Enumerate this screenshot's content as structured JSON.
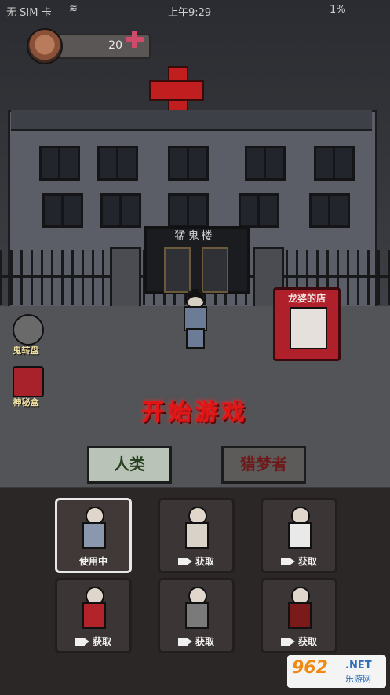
{
  "status_bar": {
    "carrier": "无 SIM 卡",
    "time": "上午9:29",
    "battery": "1%"
  },
  "currency": {
    "amount": "20"
  },
  "building": {
    "sign": "猛鬼楼"
  },
  "shop": {
    "title": "龙婆的店"
  },
  "side_buttons": [
    {
      "label": "鬼转盘",
      "icon": "wheel-icon"
    },
    {
      "label": "神秘盒",
      "icon": "mystery-box-icon"
    }
  ],
  "start_button": "开始游戏",
  "tabs": [
    {
      "label": "人类",
      "active": true
    },
    {
      "label": "猎梦者",
      "active": false
    }
  ],
  "characters": [
    {
      "caption": "使用中",
      "selected": true,
      "outfit": "#8b97ad"
    },
    {
      "caption": "获取",
      "selected": false,
      "video": true,
      "outfit": "#d8d2c8"
    },
    {
      "caption": "获取",
      "selected": false,
      "video": true,
      "outfit": "#e9e9e9"
    },
    {
      "caption": "获取",
      "selected": false,
      "video": true,
      "outfit": "#b3242a"
    },
    {
      "caption": "获取",
      "selected": false,
      "video": true,
      "outfit": "#7a7a7a"
    },
    {
      "caption": "获取",
      "selected": false,
      "video": true,
      "outfit": "#7a1a1a"
    }
  ],
  "watermark": {
    "logo": "962",
    "net": ".NET",
    "sub": "乐游网"
  }
}
